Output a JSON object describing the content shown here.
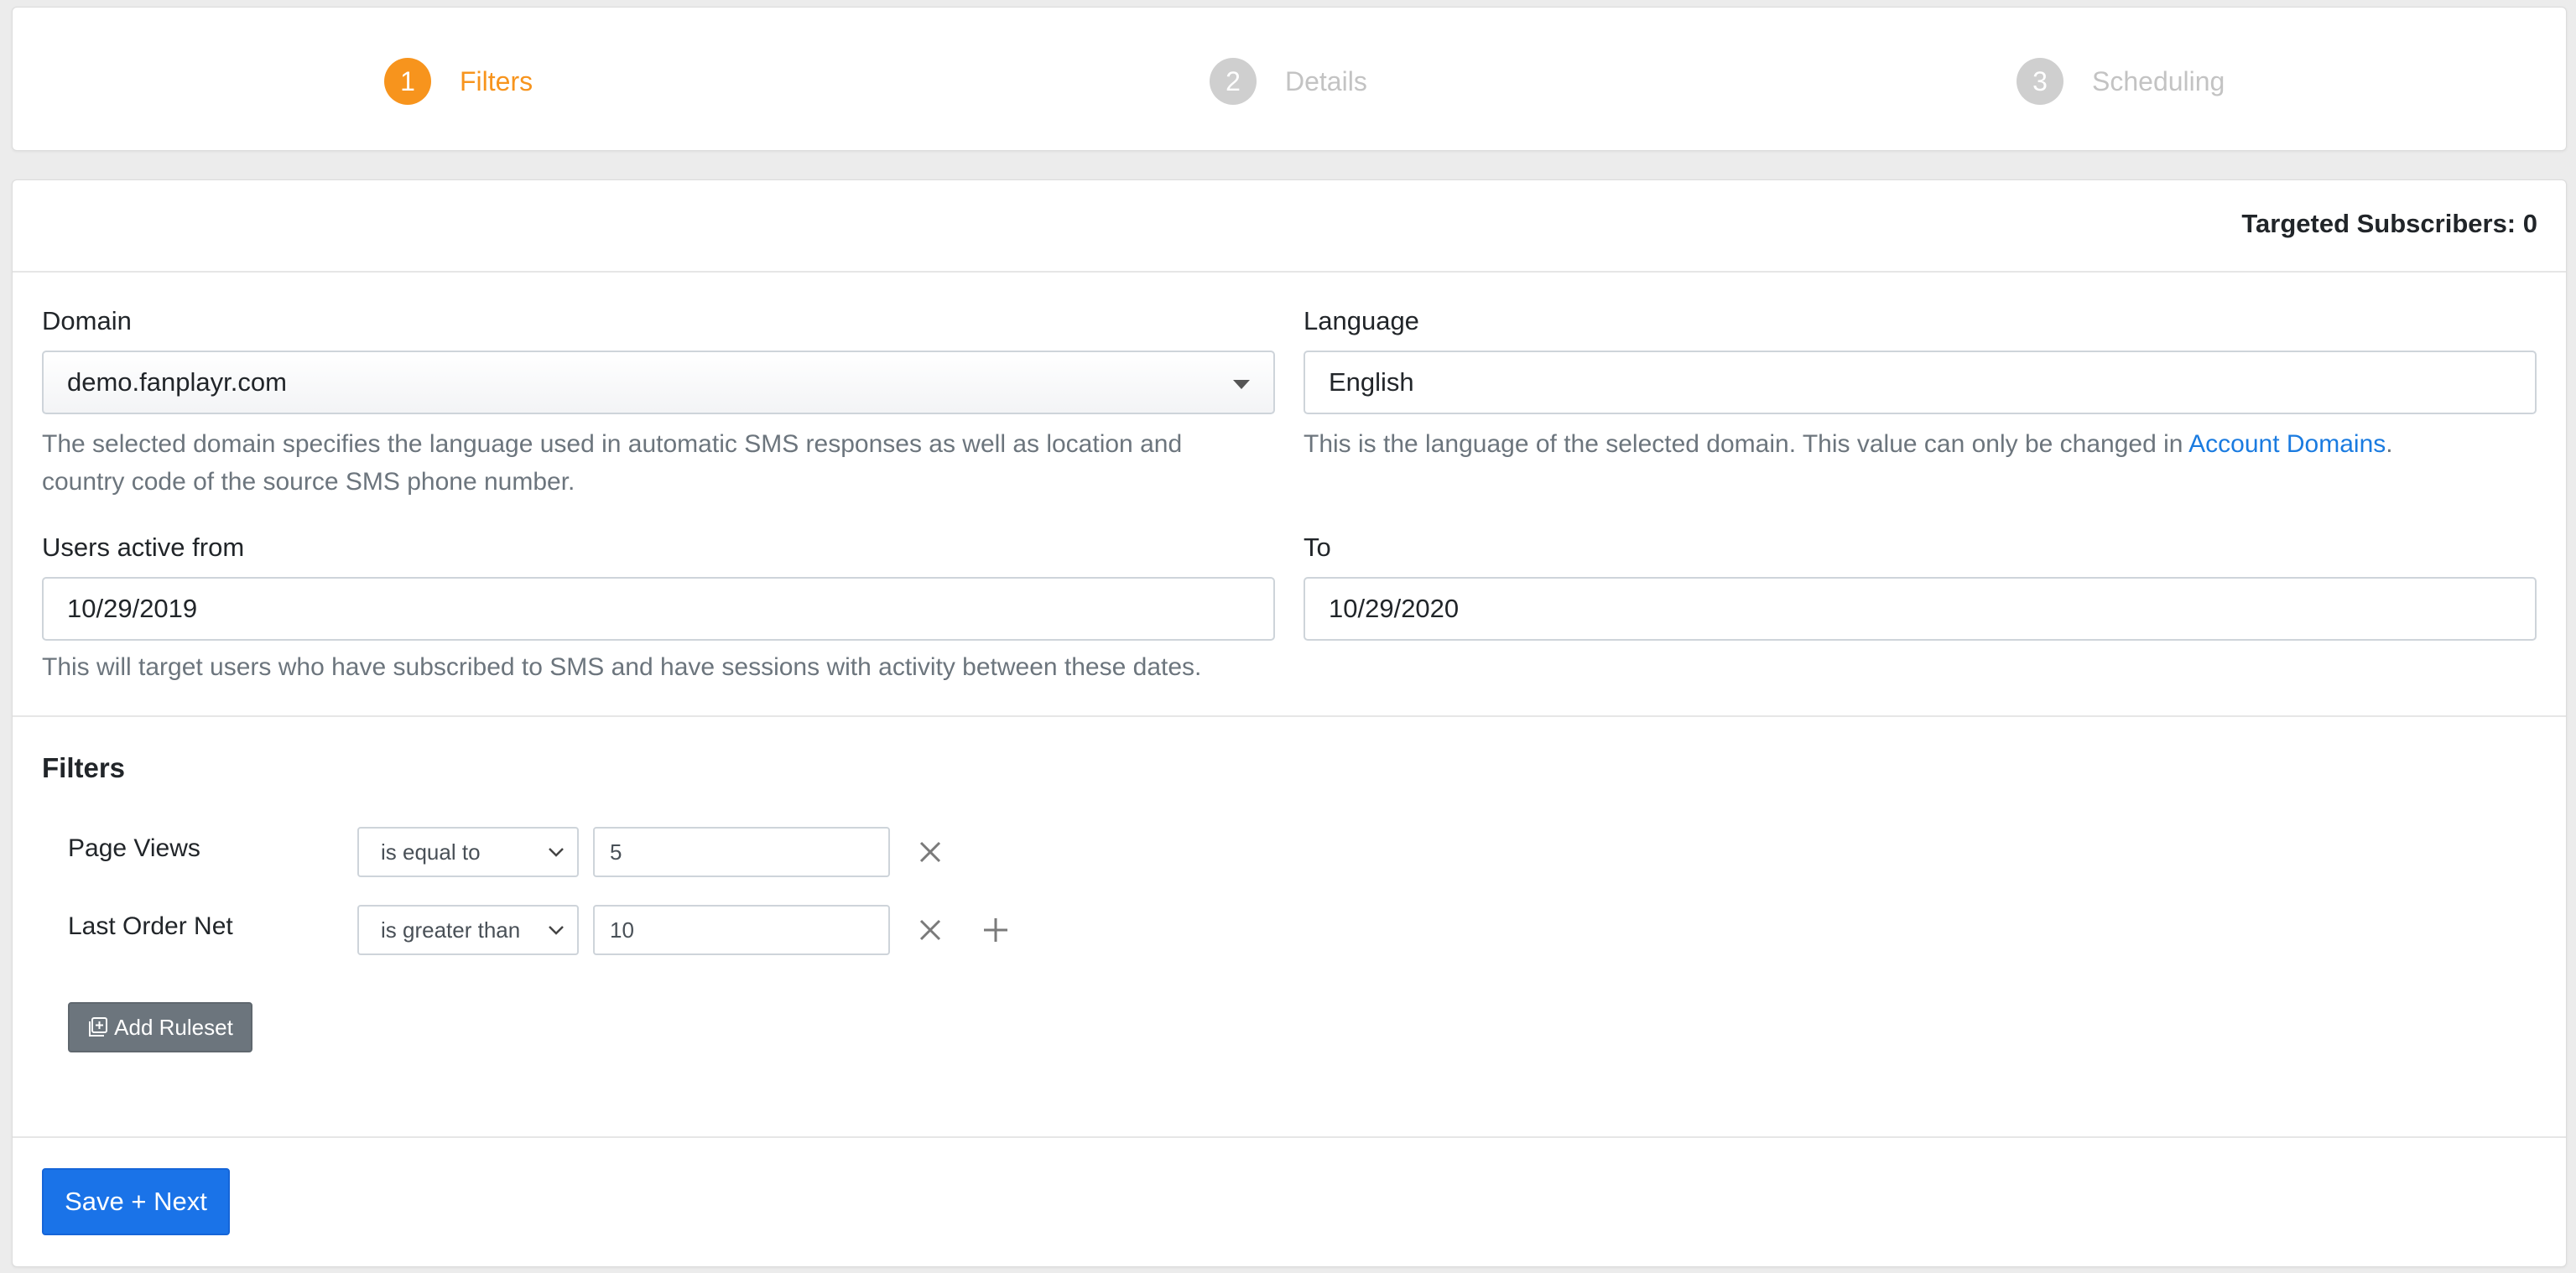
{
  "stepper": {
    "steps": [
      {
        "number": "1",
        "label": "Filters",
        "active": true
      },
      {
        "number": "2",
        "label": "Details",
        "active": false
      },
      {
        "number": "3",
        "label": "Scheduling",
        "active": false
      }
    ]
  },
  "header": {
    "targeted": "Targeted Subscribers: 0"
  },
  "domain": {
    "label": "Domain",
    "value": "demo.fanplayr.com",
    "help_line1": "The selected domain specifies the language used in automatic SMS responses as well as location and",
    "help_line2": "country code of the source SMS phone number."
  },
  "language": {
    "label": "Language",
    "value": "English",
    "help_prefix": "This is the language of the selected domain. This value can only be changed in ",
    "help_link": "Account Domains",
    "help_suffix": "."
  },
  "active_from": {
    "label": "Users active from",
    "value": "10/29/2019"
  },
  "active_to": {
    "label": "To",
    "value": "10/29/2020"
  },
  "dates_help": "This will target users who have subscribed to SMS and have sessions with activity between these dates.",
  "filters": {
    "title": "Filters",
    "rules": [
      {
        "field": "Page Views",
        "operator": "is equal to",
        "value": "5"
      },
      {
        "field": "Last Order Net",
        "operator": "is greater than",
        "value": "10"
      }
    ],
    "add_ruleset": "Add Ruleset"
  },
  "footer": {
    "save_next": "Save + Next"
  },
  "colors": {
    "accent": "#f7941d",
    "primary": "#1a73e8",
    "link": "#1a7be0",
    "secondary": "#6c757d"
  }
}
